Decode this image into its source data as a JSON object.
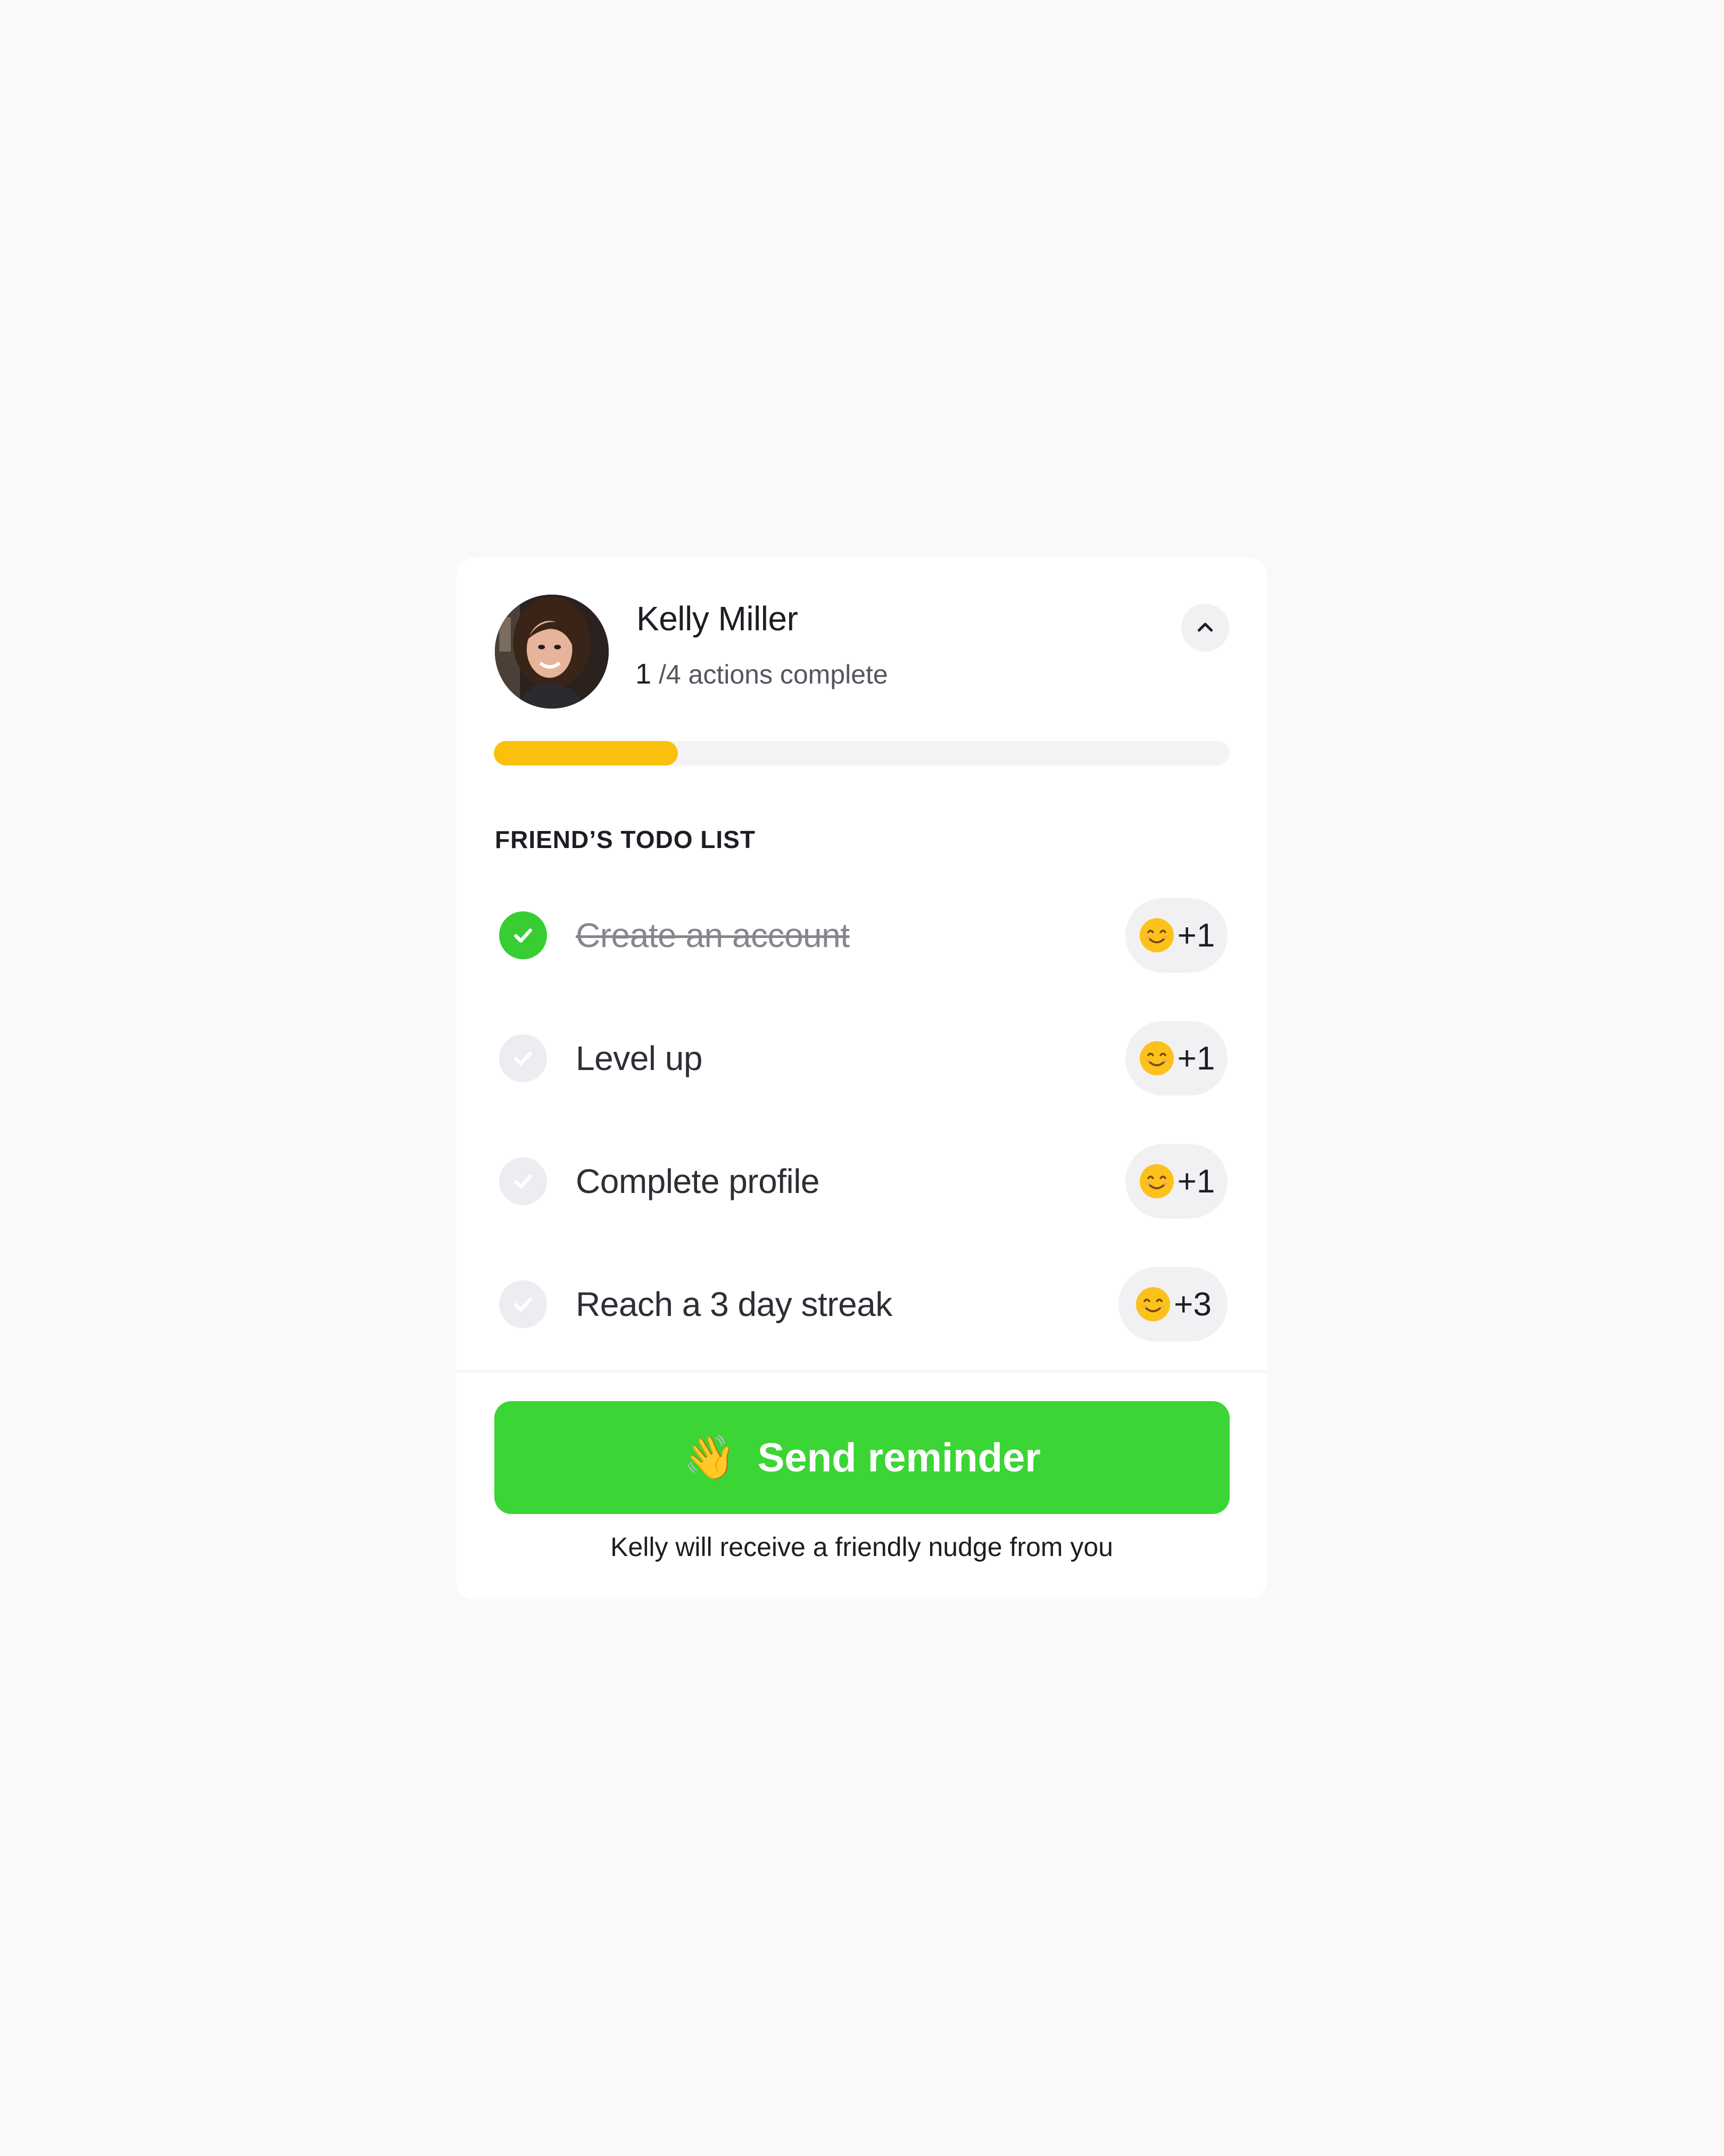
{
  "friend": {
    "name": "Kelly Miller",
    "actions_done": "1",
    "actions_rest": " /4 actions complete",
    "progress_fraction": 0.25
  },
  "todo": {
    "title": "FRIEND’S TODO LIST",
    "items": [
      {
        "label": "Create an account",
        "completed": true,
        "reward": "+1"
      },
      {
        "label": "Level up",
        "completed": false,
        "reward": "+1"
      },
      {
        "label": "Complete profile",
        "completed": false,
        "reward": "+1"
      },
      {
        "label": "Reach a 3 day streak",
        "completed": false,
        "reward": "+3"
      }
    ]
  },
  "reminder": {
    "icon": "waving-hand-icon",
    "button_label": "Send reminder",
    "hint": "Kelly will receive a friendly nudge from you"
  },
  "colors": {
    "page_background": "#f9f9f9",
    "progress": "#fbc00d",
    "success": "#37cd33",
    "button": "#3bd535"
  }
}
